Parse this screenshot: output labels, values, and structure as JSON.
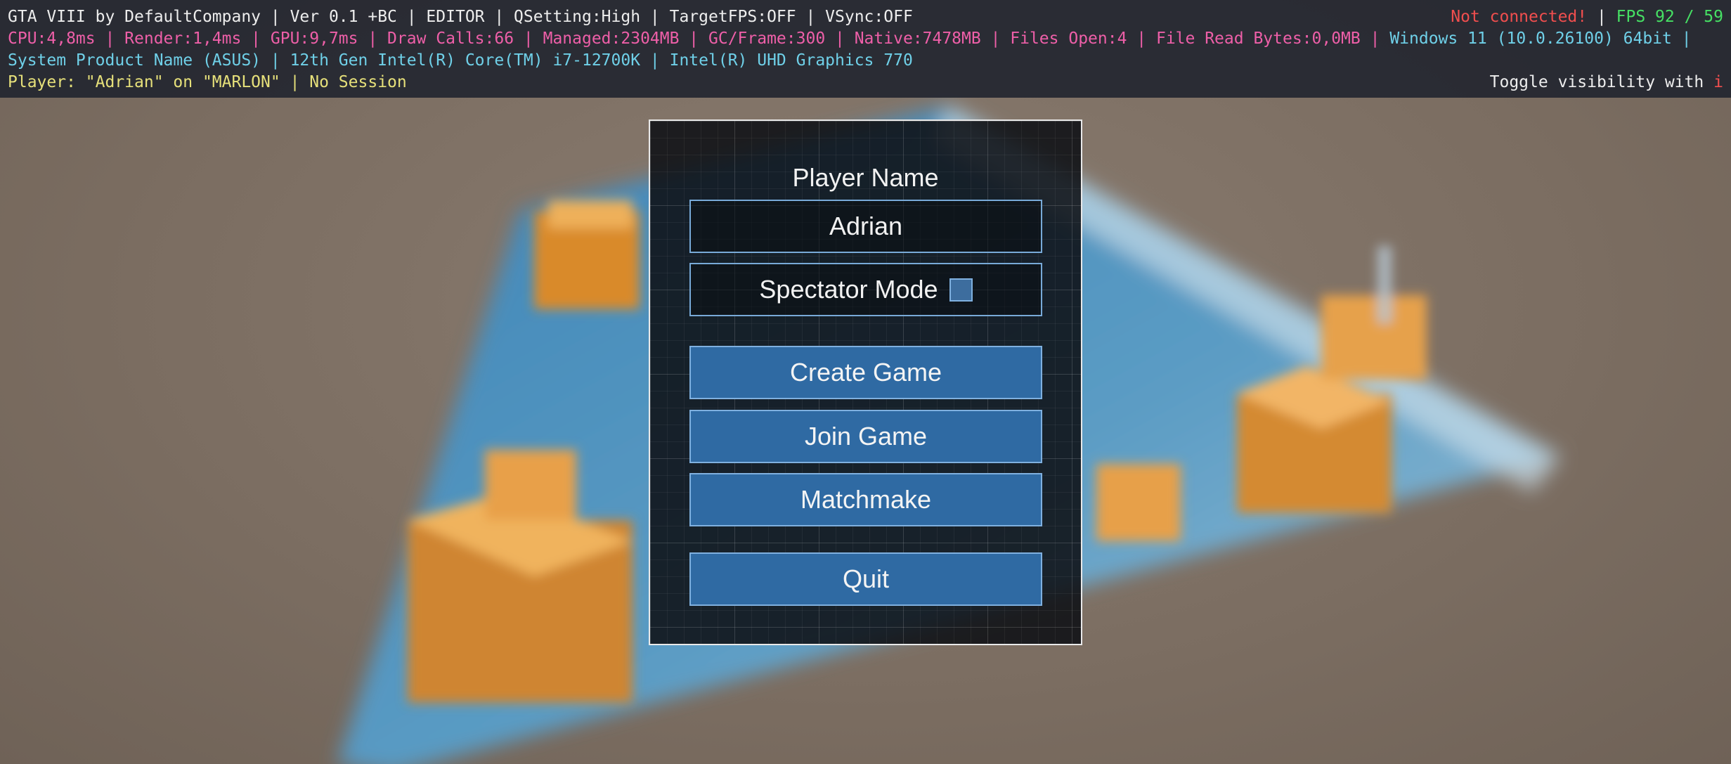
{
  "debug": {
    "line1": {
      "left": "GTA VIII by DefaultCompany | Ver 0.1 +BC | EDITOR | QSetting:High | TargetFPS:OFF | VSync:OFF",
      "connection": "Not connected!",
      "separator": " | ",
      "fps": "FPS 92 / 59"
    },
    "line2": {
      "stats": "CPU:4,8ms | Render:1,4ms | GPU:9,7ms | Draw Calls:66 | Managed:2304MB | GC/Frame:300 | Native:7478MB | Files Open:4 | File Read Bytes:0,0MB | ",
      "os": "Windows 11  (10.0.26100) 64bit |"
    },
    "line3": {
      "hardware": "System Product Name (ASUS) | 12th Gen Intel(R) Core(TM) i7-12700K | Intel(R) UHD Graphics 770"
    },
    "line4": {
      "player": "Player: \"Adrian\" on \"MARLON\" | No Session",
      "toggle_label": "Toggle visibility with ",
      "toggle_key": "i"
    }
  },
  "menu": {
    "title": "Player Name",
    "name_value": "Adrian",
    "spectator_label": "Spectator Mode",
    "spectator_checked": false,
    "buttons": {
      "create": "Create Game",
      "join": "Join Game",
      "matchmake": "Matchmake",
      "quit": "Quit"
    }
  },
  "colors": {
    "button_fill": "#2f6aa3",
    "button_border": "#7fb0df",
    "overlay_bg": "#232630",
    "stats_pink": "#ee5fa8",
    "info_cyan": "#6fd0e8",
    "player_yellow": "#e6e07a",
    "error_red": "#f04e4e",
    "fps_green": "#46e064"
  }
}
